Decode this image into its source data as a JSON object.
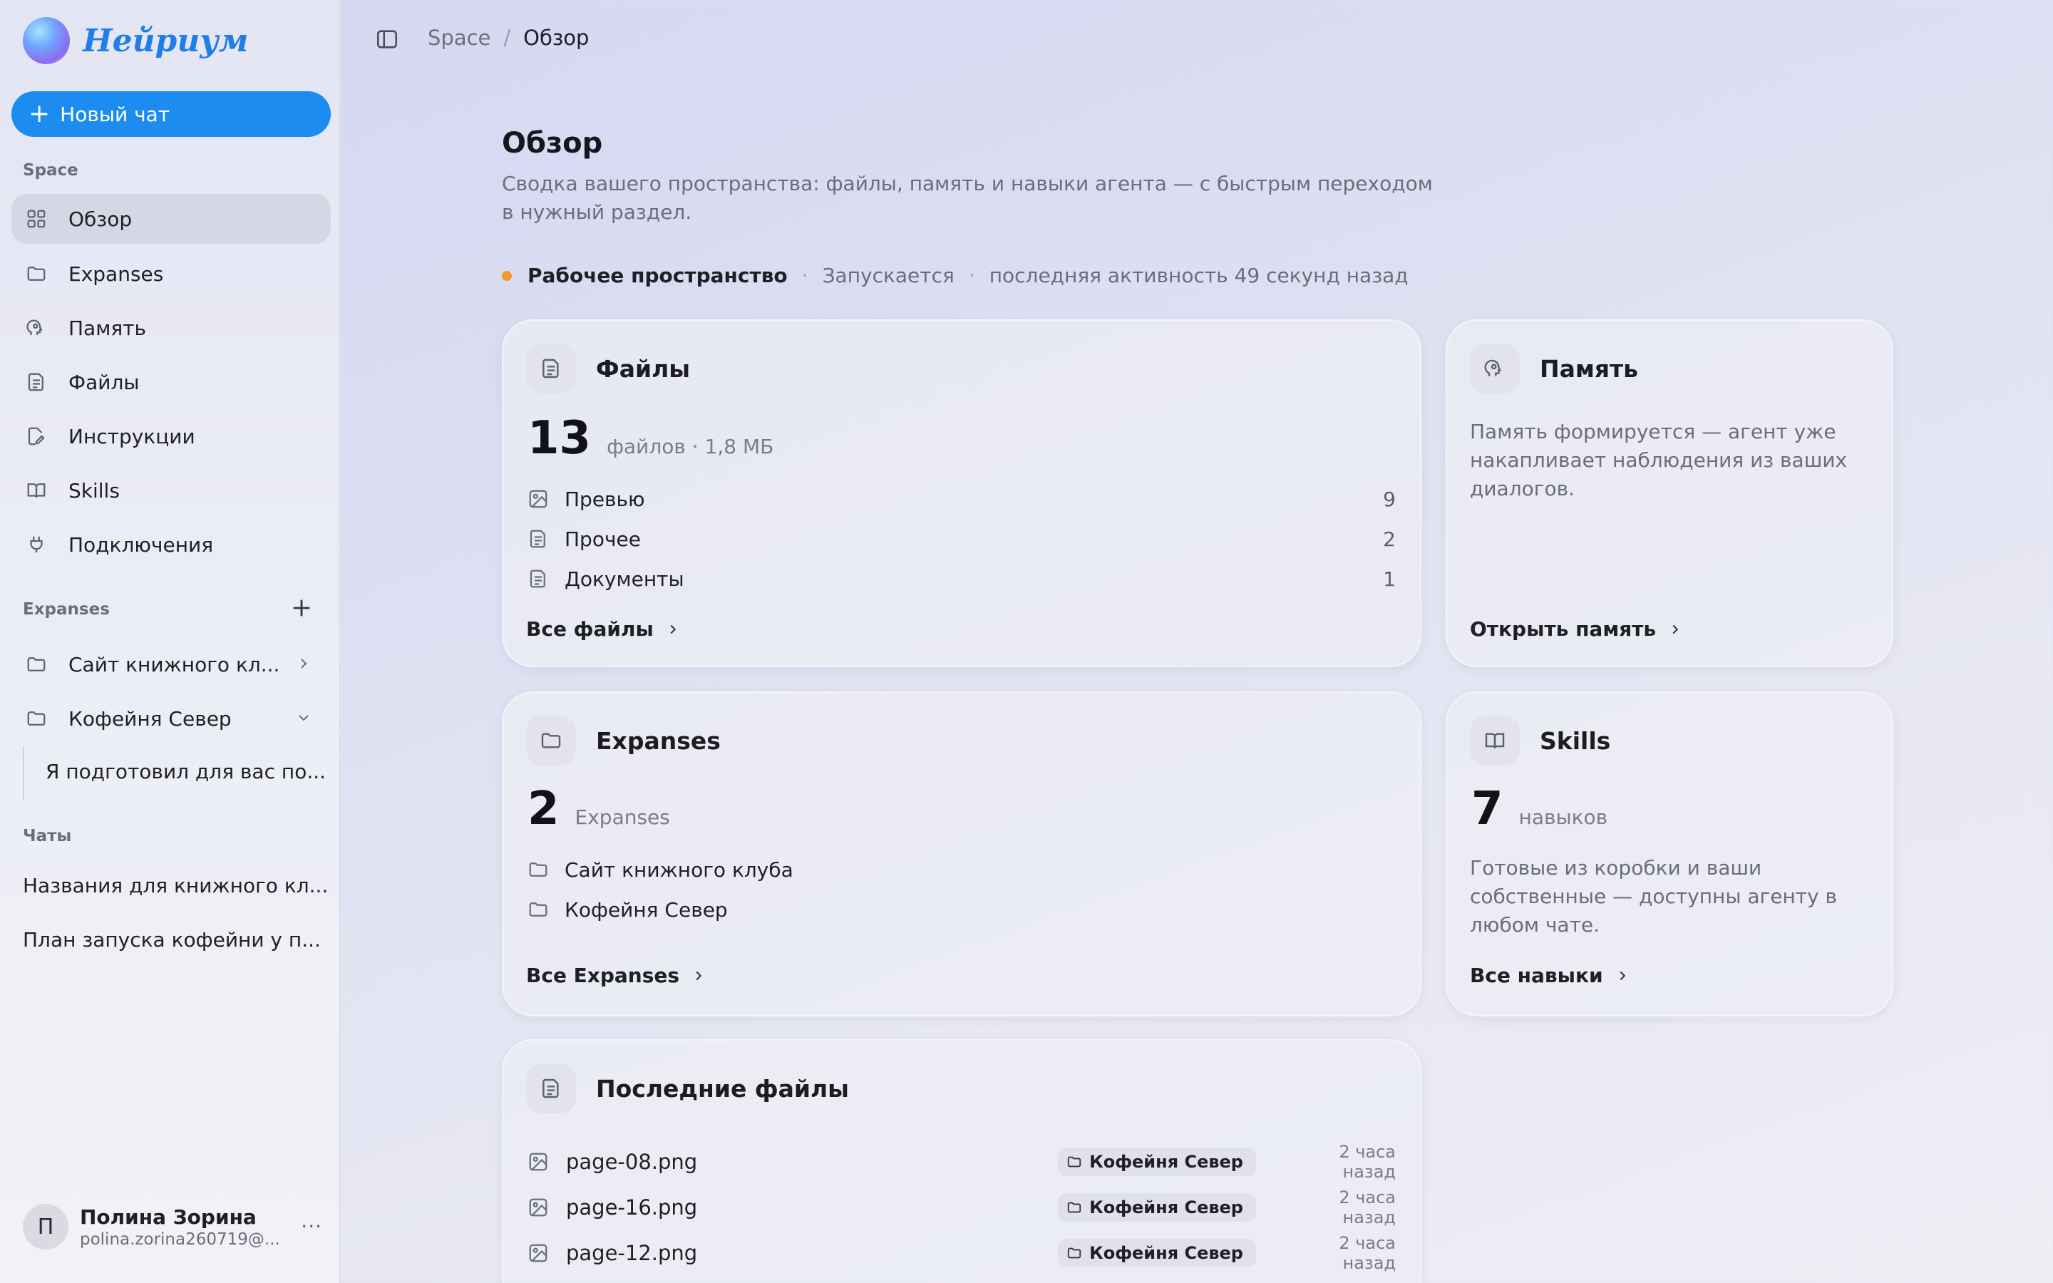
{
  "app": {
    "logo_text": "Нейриум"
  },
  "sidebar": {
    "new_chat_label": "Новый чат",
    "space_label": "Space",
    "nav": [
      {
        "label": "Обзор",
        "icon": "grid-icon",
        "active": true
      },
      {
        "label": "Expanses",
        "icon": "folder-icon"
      },
      {
        "label": "Память",
        "icon": "brain-head-icon"
      },
      {
        "label": "Файлы",
        "icon": "file-icon"
      },
      {
        "label": "Инструкции",
        "icon": "edit-file-icon"
      },
      {
        "label": "Skills",
        "icon": "book-icon"
      },
      {
        "label": "Подключения",
        "icon": "plug-icon"
      }
    ],
    "expanses_label": "Expanses",
    "expanses": [
      {
        "label": "Сайт книжного кл...",
        "icon": "folder-icon",
        "state": "collapsed"
      },
      {
        "label": "Кофейня Север",
        "icon": "folder-icon",
        "state": "expanded"
      }
    ],
    "expanse_sub_item": "Я подготовил для вас по...",
    "chats_label": "Чаты",
    "chats": [
      "Названия для книжного кл...",
      "План запуска кофейни у п..."
    ],
    "user": {
      "initial": "П",
      "name": "Полина Зорина",
      "email": "polina.zorina260719@...",
      "more": "···"
    }
  },
  "topbar": {
    "breadcrumb_root": "Space",
    "breadcrumb_sep": "/",
    "breadcrumb_current": "Обзор"
  },
  "main": {
    "title": "Обзор",
    "description": "Сводка вашего пространства: файлы, память и навыки агента — с быстрым переходом в нужный раздел.",
    "status": {
      "workspace": "Рабочее пространство",
      "sep": "·",
      "state": "Запускается",
      "activity": "последняя активность 49 секунд назад",
      "dot_color": "#f09a2b"
    },
    "files_card": {
      "title": "Файлы",
      "count": "13",
      "unit": "файлов · 1,8 МБ",
      "rows": [
        {
          "label": "Превью",
          "count": "9",
          "icon": "image-icon"
        },
        {
          "label": "Прочее",
          "count": "2",
          "icon": "file-icon"
        },
        {
          "label": "Документы",
          "count": "1",
          "icon": "file-icon"
        }
      ],
      "link": "Все файлы"
    },
    "memory_card": {
      "title": "Память",
      "text": "Память формируется — агент уже накапливает наблюдения из ваших диалогов.",
      "link": "Открыть память"
    },
    "expanses_card": {
      "title": "Expanses",
      "count": "2",
      "unit": "Expanses",
      "rows": [
        {
          "label": "Сайт книжного клуба",
          "icon": "folder-icon"
        },
        {
          "label": "Кофейня Север",
          "icon": "folder-icon"
        }
      ],
      "link": "Все Expanses"
    },
    "skills_card": {
      "title": "Skills",
      "count": "7",
      "unit": "навыков",
      "text": "Готовые из коробки и ваши собственные — доступны агенту в любом чате.",
      "link": "Все навыки"
    },
    "recent_card": {
      "title": "Последние файлы",
      "files": [
        {
          "name": "page-08.png",
          "tag": "Кофейня Север",
          "time": "2 часа назад"
        },
        {
          "name": "page-16.png",
          "tag": "Кофейня Север",
          "time": "2 часа назад"
        },
        {
          "name": "page-12.png",
          "tag": "Кофейня Север",
          "time": "2 часа назад"
        }
      ]
    }
  },
  "colors": {
    "accent": "#1c8cf1",
    "status_dot": "#f09a2b"
  }
}
